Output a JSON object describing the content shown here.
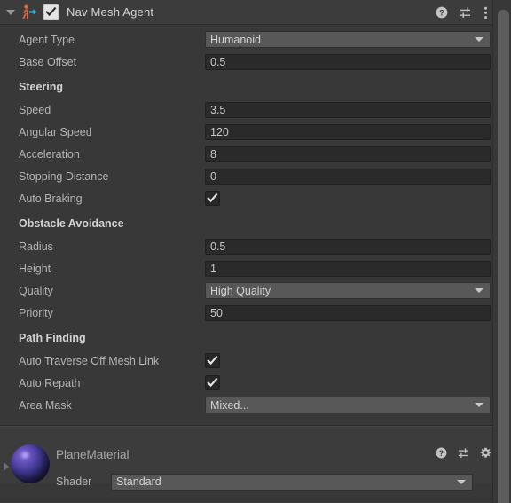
{
  "component": {
    "title": "Nav Mesh Agent",
    "icon": "nav-mesh-agent-icon",
    "enabled_checkbox": true,
    "foldout_expanded": true,
    "header_icons": [
      "help-icon",
      "preset-icon",
      "more-menu-icon"
    ],
    "sections": [
      {
        "heading": "",
        "rows": [
          {
            "label": "Agent Type",
            "type": "popup",
            "value": "Humanoid"
          },
          {
            "label": "Base Offset",
            "type": "text",
            "value": "0.5"
          }
        ]
      },
      {
        "heading": "Steering",
        "rows": [
          {
            "label": "Speed",
            "type": "text",
            "value": "3.5"
          },
          {
            "label": "Angular Speed",
            "type": "text",
            "value": "120"
          },
          {
            "label": "Acceleration",
            "type": "text",
            "value": "8"
          },
          {
            "label": "Stopping Distance",
            "type": "text",
            "value": "0"
          },
          {
            "label": "Auto Braking",
            "type": "checkbox",
            "value": true
          }
        ]
      },
      {
        "heading": "Obstacle Avoidance",
        "rows": [
          {
            "label": "Radius",
            "type": "text",
            "value": "0.5"
          },
          {
            "label": "Height",
            "type": "text",
            "value": "1"
          },
          {
            "label": "Quality",
            "type": "popup",
            "value": "High Quality"
          },
          {
            "label": "Priority",
            "type": "text",
            "value": "50"
          }
        ]
      },
      {
        "heading": "Path Finding",
        "rows": [
          {
            "label": "Auto Traverse Off Mesh Link",
            "type": "checkbox",
            "value": true
          },
          {
            "label": "Auto Repath",
            "type": "checkbox",
            "value": true
          },
          {
            "label": "Area Mask",
            "type": "popup",
            "value": "Mixed..."
          }
        ]
      }
    ]
  },
  "material": {
    "name": "PlaneMaterial",
    "preview_icon": "material-sphere-preview",
    "foldout_expanded": false,
    "header_icons": [
      "help-icon",
      "preset-icon",
      "gear-icon"
    ],
    "shader_label": "Shader",
    "shader_value": "Standard"
  },
  "colors": {
    "panel_background": "#383838",
    "header_background": "#3c3c3c",
    "text_field_background": "#2a2a2a",
    "popup_field_background": "#585858",
    "label_text": "#b4b4b4",
    "heading_text": "#d2d2d2",
    "agent_icon_body": "#e2683c",
    "agent_icon_arrow": "#33b5d8",
    "scrollbar_thumb": "#5d5d5d"
  }
}
